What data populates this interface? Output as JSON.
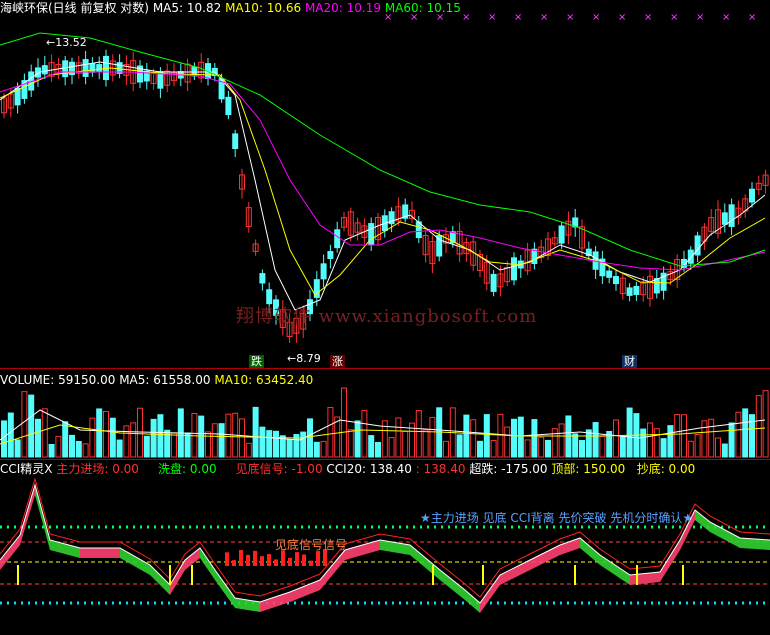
{
  "price_panel": {
    "legend": [
      {
        "text": "海峡环保(日线 前复权 对数)",
        "color": "#ffffff"
      },
      {
        "text": "MA5: 10.82",
        "color": "#ffffff"
      },
      {
        "text": "MA10: 10.66",
        "color": "#ffff00"
      },
      {
        "text": "MA20: 10.19",
        "color": "#ff00ff"
      },
      {
        "text": "MA60: 10.15",
        "color": "#00ff00"
      }
    ],
    "high_label": "13.52",
    "low_label": "8.79",
    "tag_fall": "跌",
    "tag_rise": "涨",
    "tag_fin": "财",
    "watermark": "翔博软件 www.xiangbosoft.com"
  },
  "volume_panel": {
    "legend": [
      {
        "text": "VOLUME: 59150.00",
        "color": "#ffffff"
      },
      {
        "text": "MA5: 61558.00",
        "color": "#ffffff"
      },
      {
        "text": "MA10: 63452.40",
        "color": "#ffff00"
      }
    ]
  },
  "indicator_panel": {
    "legend": [
      {
        "text": "CCI精灵X",
        "color": "#ffffff"
      },
      {
        "text": "主力进场: 0.00",
        "color": "#ff3030"
      },
      {
        "text": "洗盘: 0.00",
        "color": "#00ff00"
      },
      {
        "text": "见底信号: -1.00",
        "color": "#ff3030"
      },
      {
        "text": "CCI20: 138.40",
        "color": "#ffffff"
      },
      {
        "text": ": 138.40",
        "color": "#ff3030"
      },
      {
        "text": "超跌: -175.00",
        "color": "#ffffff"
      },
      {
        "text": "顶部: 150.00",
        "color": "#ffff00"
      },
      {
        "text": "抄底: 0.00",
        "color": "#ffff00"
      }
    ],
    "annotation_main": "★主力进场 见底 CCI背离 先价突破 先机分时确认★",
    "annotation_signal": "见底信号信号"
  },
  "colors": {
    "up": "#ff3232",
    "down": "#54fcfc",
    "ma5": "#ffffff",
    "ma10": "#ffff00",
    "ma20": "#ff00ff",
    "ma60": "#00ff00",
    "separator": "#b00000"
  }
}
